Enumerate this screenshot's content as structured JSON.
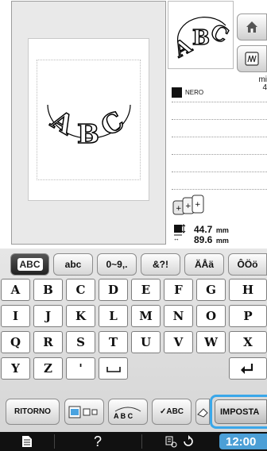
{
  "preview": {
    "text": "ABC"
  },
  "thread": {
    "color_name": "NERO",
    "mi_label": "mi",
    "count": "4"
  },
  "size": {
    "width_value": "44.7",
    "width_unit": "mm",
    "height_value": "89.6",
    "height_unit": "mm"
  },
  "tabs": [
    {
      "label": "ABC"
    },
    {
      "label": "abc"
    },
    {
      "label": "0~9,."
    },
    {
      "label": "&?!"
    },
    {
      "label": "ÄÅä"
    },
    {
      "label": "ÔÖö"
    }
  ],
  "keys": {
    "row1": [
      "A",
      "B",
      "C",
      "D",
      "E",
      "F",
      "G",
      "H"
    ],
    "row2": [
      "I",
      "J",
      "K",
      "L",
      "M",
      "N",
      "O",
      "P"
    ],
    "row3": [
      "Q",
      "R",
      "S",
      "T",
      "U",
      "V",
      "W",
      "X"
    ],
    "row4": [
      "Y",
      "Z",
      "'"
    ]
  },
  "buttons": {
    "back": "RITORNO",
    "spacing_text": "A B C",
    "check_text": "✓ABC",
    "set": "IMPOSTA"
  },
  "status": {
    "clock": "12:00",
    "help": "?"
  }
}
